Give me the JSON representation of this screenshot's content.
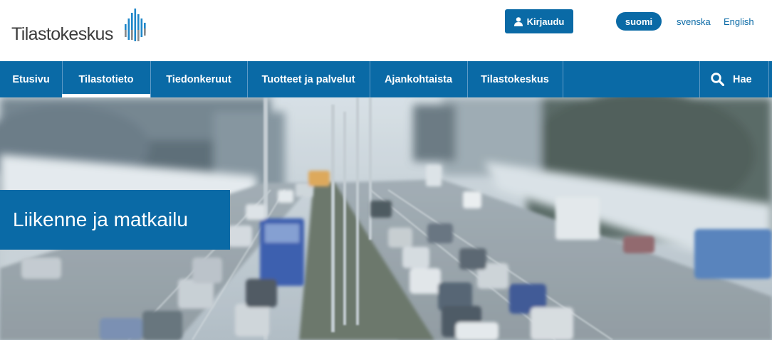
{
  "brand": {
    "name": "Tilastokeskus",
    "accent_color": "#0a6aa6",
    "logo_icon": "vertical-bars-logo"
  },
  "header": {
    "login_label": "Kirjaudu",
    "login_icon": "user-icon",
    "languages": [
      {
        "label": "suomi",
        "active": true
      },
      {
        "label": "svenska",
        "active": false
      },
      {
        "label": "English",
        "active": false
      }
    ]
  },
  "nav": {
    "items": [
      {
        "label": "Etusivu",
        "active": false
      },
      {
        "label": "Tilastotieto",
        "active": true
      },
      {
        "label": "Tiedonkeruut",
        "active": false
      },
      {
        "label": "Tuotteet ja palvelut",
        "active": false
      },
      {
        "label": "Ajankohtaista",
        "active": false
      },
      {
        "label": "Tilastokeskus",
        "active": false
      }
    ],
    "search_label": "Hae",
    "search_icon": "search-icon"
  },
  "hero": {
    "title": "Liikenne ja matkailu",
    "image": "motion-blurred-highway-traffic-photo"
  }
}
